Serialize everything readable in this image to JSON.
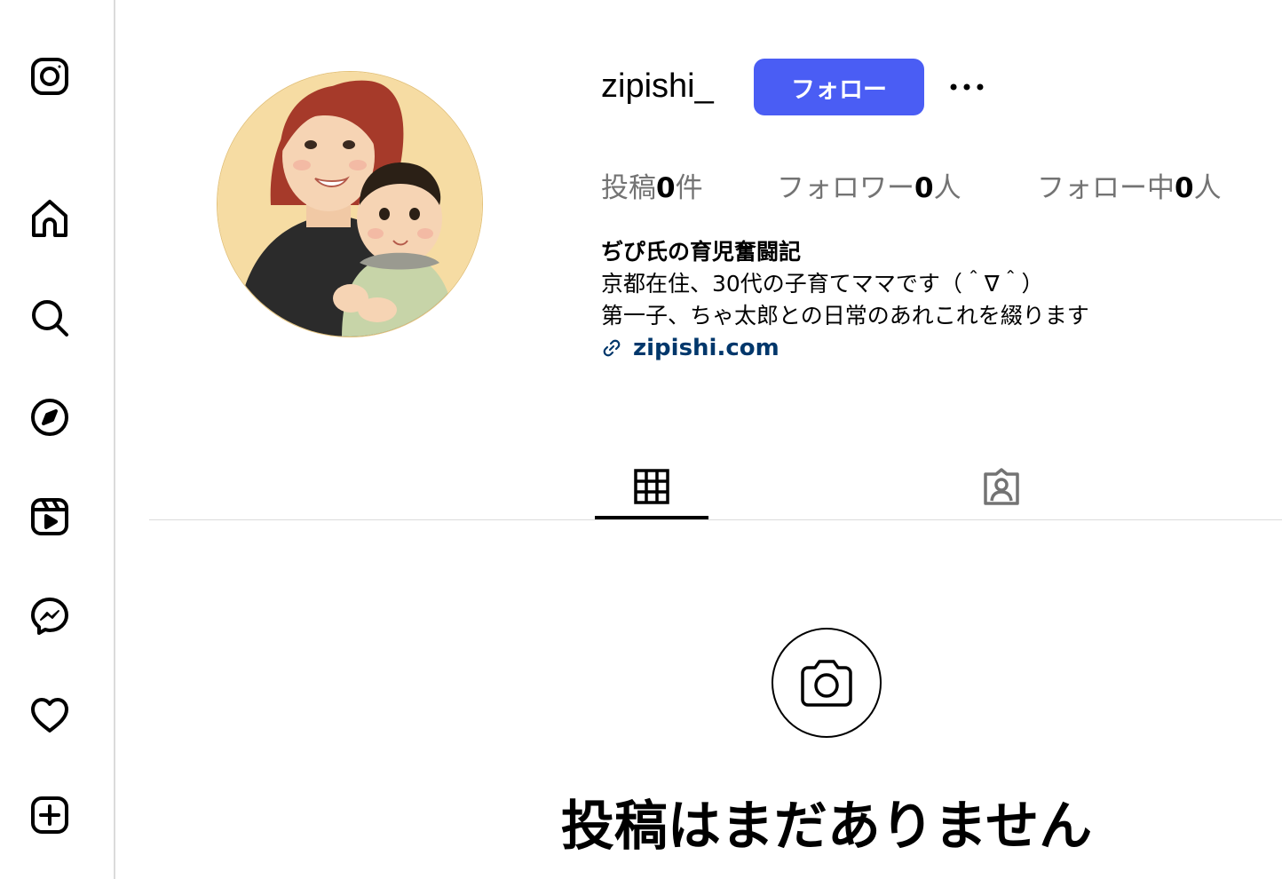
{
  "sidebar": {
    "items": [
      {
        "name": "instagram-logo-icon"
      },
      {
        "name": "home-icon"
      },
      {
        "name": "search-icon"
      },
      {
        "name": "explore-compass-icon"
      },
      {
        "name": "reels-icon"
      },
      {
        "name": "messenger-icon"
      },
      {
        "name": "heart-icon"
      },
      {
        "name": "create-plus-icon"
      }
    ]
  },
  "profile": {
    "username": "zipishi_",
    "follow_label": "フォロー",
    "more_icon": "more-horizontal-icon",
    "stats": {
      "posts_label_pre": "投稿",
      "posts_count": "0",
      "posts_label_post": "件",
      "followers_label_pre": "フォロワー",
      "followers_count": "0",
      "followers_label_post": "人",
      "following_label_pre": "フォロー中",
      "following_count": "0",
      "following_label_post": "人"
    },
    "bio": {
      "name": "ぢぴ氏の育児奮闘記",
      "line1": "京都在住、30代の子育てママです（＾∇＾）",
      "line2": "第一子、ちゃ太郎との日常のあれこれを綴ります",
      "link": "zipishi.com"
    }
  },
  "tabs": [
    {
      "name": "posts-grid-icon",
      "active": true
    },
    {
      "name": "tagged-icon",
      "active": false
    }
  ],
  "empty_state": {
    "icon": "camera-icon",
    "title": "投稿はまだありません"
  },
  "colors": {
    "follow_button": "#4a5df4",
    "link": "#00376b",
    "muted": "#737373",
    "divider": "#dbdbdb"
  }
}
